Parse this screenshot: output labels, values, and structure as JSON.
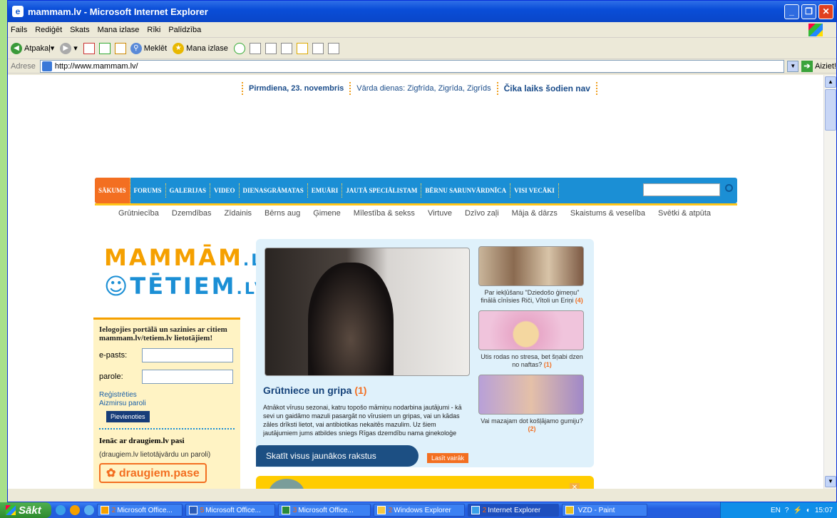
{
  "window": {
    "title": "mammam.lv - Microsoft Internet Explorer"
  },
  "menu": [
    "Fails",
    "Rediģēt",
    "Skats",
    "Mana izlase",
    "Rīki",
    "Palīdzība"
  ],
  "toolbar": {
    "back": "Atpakaļ",
    "search": "Meklēt",
    "favorites": "Mana izlase"
  },
  "address": {
    "label": "Adrese",
    "url": "http://www.mammam.lv/",
    "go": "Aiziet!"
  },
  "topline": {
    "date": "Pirmdiena, 23. novembris",
    "names": "Vārda dienas: Zigfrīda, Zigrīda, Zigrīds",
    "pig": "Čika laiks šodien nav"
  },
  "nav": [
    "SĀKUMS",
    "FORUMS",
    "GALERIJAS",
    "VIDEO",
    "DIENASGRĀMATAS",
    "EMUĀRI",
    "JAUTĀ SPECIĀLISTAM",
    "BĒRNU SARUNVĀRDNĪCA",
    "VISI VECĀKI"
  ],
  "subnav": [
    "Grūtniecība",
    "Dzemdības",
    "Zīdainis",
    "Bērns aug",
    "Ģimene",
    "Mīlestība & sekss",
    "Virtuve",
    "Dzīvo zaļi",
    "Māja & dārzs",
    "Skaistums & veselība",
    "Svētki & atpūta"
  ],
  "logo": {
    "line1": "MAMMĀM",
    "line1_tld": ".LV",
    "line2": "☺TĒTIEM",
    "line2_tld": ".LV"
  },
  "login": {
    "heading": "Ielogojies portālā un sazinies ar citiem mammam.lv/tetiem.lv lietotājiem!",
    "email_label": "e-pasts:",
    "password_label": "parole:",
    "register": "Reģistrēties",
    "forgot": "Aizmirsu paroli",
    "submit": "Pievienoties",
    "draugiem_heading": "Ienāc ar draugiem.lv pasi",
    "draugiem_note": "(draugiem.lv lietotājvārdu un paroli)",
    "draugiem_button": "draugiem.pase"
  },
  "feature": {
    "title": "Grūtniece un gripa",
    "count": "(1)",
    "text": "Atnākot vīrusu sezonai, katru topošo māmiņu nodarbina jautājumi - kā sevi un gaidāmo mazuli pasargāt no vīrusiem un gripas, vai un kādas zāles drīksti lietot, vai antibiotikas nekaitēs mazulim. Uz šiem jautājumiem jums atbildes sniegs Rīgas dzemdību nama ginekoloģe",
    "latest": "Skatīt visus jaunākos rakstus",
    "read_more": "Lasīt vairāk"
  },
  "thumbs": [
    {
      "caption": "Par iekļūšanu \"Dziedošo ģimeņu\" finālā cīnīsies Riči, Vītoli un Eriņi",
      "count": "(4)"
    },
    {
      "caption": "Utis rodas no stresa, bet šņabi dzen no naftas?",
      "count": "(1)"
    },
    {
      "caption": "Vai mazajam dot košļājamo gumiju?",
      "count": "(2)"
    }
  ],
  "taskbar": {
    "start": "Sākt",
    "tasks": [
      {
        "num": "2",
        "label": "Microsoft Office..."
      },
      {
        "num": "5",
        "label": "Microsoft Office..."
      },
      {
        "num": "3",
        "label": "Microsoft Office..."
      },
      {
        "num": "2",
        "label": "Windows Explorer"
      },
      {
        "num": "2",
        "label": "Internet Explorer"
      },
      {
        "num": "",
        "label": "VZD - Paint"
      }
    ],
    "lang": "EN",
    "clock": "15:07"
  },
  "colors": {
    "nav_blue": "#1b8fd5",
    "accent_orange": "#f36f21",
    "logo_yellow": "#f5a000"
  }
}
